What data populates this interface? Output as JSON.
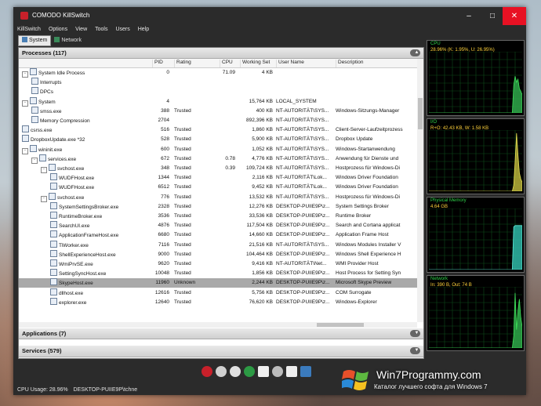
{
  "window": {
    "title": "COMODO KillSwitch",
    "controls": {
      "minimize": "–",
      "maximize": "□",
      "close": "✕"
    }
  },
  "menu": [
    "KillSwitch",
    "Options",
    "View",
    "Tools",
    "Users",
    "Help"
  ],
  "tabs": [
    {
      "label": "System",
      "active": true
    },
    {
      "label": "Network",
      "active": false
    }
  ],
  "sections": {
    "processes": "Processes (117)",
    "applications": "Applications (7)",
    "services": "Services (579)"
  },
  "columns": [
    "PID",
    "Rating",
    "CPU",
    "Working Set",
    "User Name",
    "Description"
  ],
  "processes": [
    {
      "indent": 0,
      "exp": "-",
      "name": "System Idle Process",
      "pid": "0",
      "rating": "",
      "cpu": "71.09",
      "ws": "4 KB",
      "user": "",
      "desc": ""
    },
    {
      "indent": 1,
      "exp": "",
      "name": "Interrupts",
      "pid": "",
      "rating": "",
      "cpu": "",
      "ws": "",
      "user": "",
      "desc": ""
    },
    {
      "indent": 1,
      "exp": "",
      "name": "DPCs",
      "pid": "",
      "rating": "",
      "cpu": "",
      "ws": "",
      "user": "",
      "desc": ""
    },
    {
      "indent": 0,
      "exp": "-",
      "name": "System",
      "pid": "4",
      "rating": "",
      "cpu": "",
      "ws": "15,764 KB",
      "user": "LOCAL_SYSTEM",
      "desc": ""
    },
    {
      "indent": 1,
      "exp": "",
      "name": "smss.exe",
      "pid": "388",
      "rating": "Trusted",
      "cpu": "",
      "ws": "400 KB",
      "user": "NT-AUTORITÄT\\SYS...",
      "desc": "Windows-Sitzungs-Manager"
    },
    {
      "indent": 1,
      "exp": "",
      "name": "Memory Compression",
      "pid": "2704",
      "rating": "",
      "cpu": "",
      "ws": "892,396 KB",
      "user": "NT-AUTORITÄT\\SYS...",
      "desc": ""
    },
    {
      "indent": 0,
      "exp": "",
      "name": "csrss.exe",
      "pid": "516",
      "rating": "Trusted",
      "cpu": "",
      "ws": "1,860 KB",
      "user": "NT-AUTORITÄT\\SYS...",
      "desc": "Client-Server-Laufzeitprozess"
    },
    {
      "indent": 0,
      "exp": "",
      "name": "DropboxUpdate.exe *32",
      "pid": "528",
      "rating": "Trusted",
      "cpu": "",
      "ws": "5,900 KB",
      "user": "NT-AUTORITÄT\\SYS...",
      "desc": "Dropbox Update"
    },
    {
      "indent": 0,
      "exp": "-",
      "name": "wininit.exe",
      "pid": "600",
      "rating": "Trusted",
      "cpu": "",
      "ws": "1,052 KB",
      "user": "NT-AUTORITÄT\\SYS...",
      "desc": "Windows-Startanwendung"
    },
    {
      "indent": 1,
      "exp": "-",
      "name": "services.exe",
      "pid": "672",
      "rating": "Trusted",
      "cpu": "0.78",
      "ws": "4,776 KB",
      "user": "NT-AUTORITÄT\\SYS...",
      "desc": "Anwendung für Dienste und"
    },
    {
      "indent": 2,
      "exp": "-",
      "name": "svchost.exe",
      "pid": "348",
      "rating": "Trusted",
      "cpu": "0.39",
      "ws": "109,724 KB",
      "user": "NT-AUTORITÄT\\SYS...",
      "desc": "Hostprozess für Windows-Di"
    },
    {
      "indent": 3,
      "exp": "",
      "name": "WUDFHost.exe",
      "pid": "1344",
      "rating": "Trusted",
      "cpu": "",
      "ws": "2,116 KB",
      "user": "NT-AUTORITÄT\\Lok...",
      "desc": "Windows Driver Foundation"
    },
    {
      "indent": 3,
      "exp": "",
      "name": "WUDFHost.exe",
      "pid": "6512",
      "rating": "Trusted",
      "cpu": "",
      "ws": "9,452 KB",
      "user": "NT-AUTORITÄT\\Lok...",
      "desc": "Windows Driver Foundation"
    },
    {
      "indent": 2,
      "exp": "-",
      "name": "svchost.exe",
      "pid": "776",
      "rating": "Trusted",
      "cpu": "",
      "ws": "13,532 KB",
      "user": "NT-AUTORITÄT\\SYS...",
      "desc": "Hostprozess für Windows-Di"
    },
    {
      "indent": 3,
      "exp": "",
      "name": "SystemSettingsBroker.exe",
      "pid": "2328",
      "rating": "Trusted",
      "cpu": "",
      "ws": "12,276 KB",
      "user": "DESKTOP-PUIIE9P\\z...",
      "desc": "System Settings Broker"
    },
    {
      "indent": 3,
      "exp": "",
      "name": "RuntimeBroker.exe",
      "pid": "3536",
      "rating": "Trusted",
      "cpu": "",
      "ws": "33,536 KB",
      "user": "DESKTOP-PUIIE9P\\z...",
      "desc": "Runtime Broker"
    },
    {
      "indent": 3,
      "exp": "",
      "name": "SearchUI.exe",
      "pid": "4876",
      "rating": "Trusted",
      "cpu": "",
      "ws": "117,504 KB",
      "user": "DESKTOP-PUIIE9P\\z...",
      "desc": "Search and Cortana applicat"
    },
    {
      "indent": 3,
      "exp": "",
      "name": "ApplicationFrameHost.exe",
      "pid": "6680",
      "rating": "Trusted",
      "cpu": "",
      "ws": "14,660 KB",
      "user": "DESKTOP-PUIIE9P\\z...",
      "desc": "Application Frame Host"
    },
    {
      "indent": 3,
      "exp": "",
      "name": "TiWorker.exe",
      "pid": "7116",
      "rating": "Trusted",
      "cpu": "",
      "ws": "21,516 KB",
      "user": "NT-AUTORITÄT\\SYS...",
      "desc": "Windows Modules Installer V"
    },
    {
      "indent": 3,
      "exp": "",
      "name": "ShellExperienceHost.exe",
      "pid": "9000",
      "rating": "Trusted",
      "cpu": "",
      "ws": "104,464 KB",
      "user": "DESKTOP-PUIIE9P\\z...",
      "desc": "Windows Shell Experience H"
    },
    {
      "indent": 3,
      "exp": "",
      "name": "WmiPrvSE.exe",
      "pid": "9620",
      "rating": "Trusted",
      "cpu": "",
      "ws": "9,416 KB",
      "user": "NT-AUTORITÄT\\Net...",
      "desc": "WMI Provider Host"
    },
    {
      "indent": 3,
      "exp": "",
      "name": "SettingSyncHost.exe",
      "pid": "10048",
      "rating": "Trusted",
      "cpu": "",
      "ws": "1,856 KB",
      "user": "DESKTOP-PUIIE9P\\z...",
      "desc": "Host Process for Setting Syn"
    },
    {
      "indent": 3,
      "exp": "",
      "name": "SkypeHost.exe",
      "pid": "11960",
      "rating": "Unknown",
      "cpu": "",
      "ws": "2,244 KB",
      "user": "DESKTOP-PUIIE9P\\z...",
      "desc": "Microsoft Skype Preview",
      "selected": true
    },
    {
      "indent": 3,
      "exp": "",
      "name": "dllhost.exe",
      "pid": "12616",
      "rating": "Trusted",
      "cpu": "",
      "ws": "5,756 KB",
      "user": "DESKTOP-PUIIE9P\\z...",
      "desc": "COM Surrogate"
    },
    {
      "indent": 3,
      "exp": "",
      "name": "explorer.exe",
      "pid": "12640",
      "rating": "Trusted",
      "cpu": "",
      "ws": "76,620 KB",
      "user": "DESKTOP-PUIIE9P\\z...",
      "desc": "Windows-Explorer"
    }
  ],
  "graphs": [
    {
      "label": "CPU",
      "values": "28.96% (K: 1.95%, U: 26.95%)",
      "fill": "#2fa84a",
      "fill2": "#c07a2a",
      "line": "#3fe35a",
      "history": [
        0,
        0,
        0,
        0,
        0,
        0,
        0,
        0,
        0,
        0,
        0,
        0,
        0,
        0,
        0,
        0,
        0,
        0,
        0,
        0,
        0,
        0,
        0,
        0,
        0,
        0,
        0,
        0,
        0,
        0,
        0,
        0,
        0,
        0,
        0,
        0,
        0,
        0,
        0,
        0,
        0,
        0,
        0,
        0,
        0,
        0,
        0,
        0,
        0,
        0,
        0,
        0,
        0,
        0,
        0,
        0,
        0,
        0,
        0,
        0,
        0.45,
        0.6,
        0.5,
        0.55,
        0.4,
        0.35,
        0.3
      ]
    },
    {
      "label": "I/O",
      "values": "R+O: 42.43 KB, W: 1.58 KB",
      "fill": "#b8b13a",
      "fill2": "#b8b13a",
      "line": "#e6df52",
      "history": [
        0,
        0,
        0,
        0,
        0,
        0,
        0,
        0,
        0,
        0,
        0,
        0,
        0,
        0,
        0,
        0,
        0,
        0,
        0,
        0,
        0,
        0,
        0,
        0,
        0,
        0,
        0,
        0,
        0,
        0,
        0,
        0,
        0,
        0,
        0,
        0,
        0,
        0,
        0,
        0,
        0,
        0,
        0,
        0,
        0,
        0,
        0,
        0,
        0,
        0,
        0,
        0,
        0,
        0,
        0,
        0,
        0,
        0,
        0,
        0,
        0.1,
        0.5,
        0.95,
        0.6,
        0.3,
        0.2,
        0.15
      ]
    },
    {
      "label": "Physical Memory",
      "values": "4.64 GB",
      "fill": "#2fb8a8",
      "fill2": "#2fb8a8",
      "line": "#5ff0de",
      "history": [
        0,
        0,
        0,
        0,
        0,
        0,
        0,
        0,
        0,
        0,
        0,
        0,
        0,
        0,
        0,
        0,
        0,
        0,
        0,
        0,
        0,
        0,
        0,
        0,
        0,
        0,
        0,
        0,
        0,
        0,
        0,
        0,
        0,
        0,
        0,
        0,
        0,
        0,
        0,
        0,
        0,
        0,
        0,
        0,
        0,
        0,
        0,
        0,
        0,
        0,
        0,
        0,
        0,
        0,
        0,
        0,
        0,
        0,
        0,
        0,
        0.7,
        0.72,
        0.72,
        0.72,
        0.72,
        0.72,
        0.72
      ]
    },
    {
      "label": "Network",
      "values": "In: 390 B, Out: 74 B",
      "fill": "#2fa84a",
      "fill2": "#2fa84a",
      "line": "#3fe35a",
      "history": [
        0,
        0,
        0,
        0,
        0,
        0,
        0,
        0,
        0,
        0,
        0,
        0,
        0,
        0,
        0,
        0,
        0,
        0,
        0,
        0,
        0,
        0,
        0,
        0,
        0,
        0,
        0,
        0,
        0,
        0,
        0,
        0,
        0,
        0,
        0,
        0,
        0,
        0,
        0,
        0,
        0,
        0,
        0,
        0,
        0,
        0,
        0,
        0,
        0,
        0,
        0,
        0,
        0,
        0,
        0,
        0,
        0,
        0,
        0,
        0,
        0.2,
        0.9,
        0.3,
        0.6,
        0.8,
        0.5,
        0.35
      ]
    }
  ],
  "statusbar": {
    "cpu": "CPU Usage: 28.96%",
    "user": "DESKTOP-PUIIE9P\\tchne"
  },
  "toolbar_icons": [
    "comodo-icon",
    "tools-icon",
    "killswitch-icon",
    "browser-icon",
    "video-icon",
    "globe-icon",
    "window-icon",
    "network-icon"
  ],
  "watermark": {
    "site": "Win7Programmy.com",
    "tagline": "Каталог лучшего софта для Windows 7"
  }
}
